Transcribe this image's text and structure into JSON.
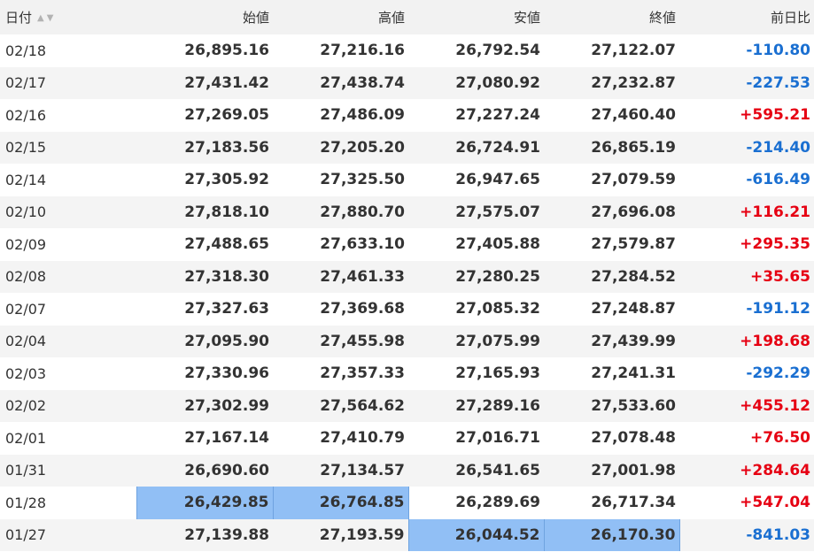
{
  "headers": {
    "date": "日付",
    "open": "始値",
    "high": "高値",
    "low": "安値",
    "close": "終値",
    "change": "前日比",
    "sort_up": "▲",
    "sort_down": "▼"
  },
  "colors": {
    "positive": "#e60012",
    "negative": "#1a6fd1",
    "highlight": "#91bff5"
  },
  "rows": [
    {
      "date": "02/18",
      "open": "26,895.16",
      "high": "27,216.16",
      "low": "26,792.54",
      "close": "27,122.07",
      "change": "-110.80"
    },
    {
      "date": "02/17",
      "open": "27,431.42",
      "high": "27,438.74",
      "low": "27,080.92",
      "close": "27,232.87",
      "change": "-227.53"
    },
    {
      "date": "02/16",
      "open": "27,269.05",
      "high": "27,486.09",
      "low": "27,227.24",
      "close": "27,460.40",
      "change": "+595.21"
    },
    {
      "date": "02/15",
      "open": "27,183.56",
      "high": "27,205.20",
      "low": "26,724.91",
      "close": "26,865.19",
      "change": "-214.40"
    },
    {
      "date": "02/14",
      "open": "27,305.92",
      "high": "27,325.50",
      "low": "26,947.65",
      "close": "27,079.59",
      "change": "-616.49"
    },
    {
      "date": "02/10",
      "open": "27,818.10",
      "high": "27,880.70",
      "low": "27,575.07",
      "close": "27,696.08",
      "change": "+116.21"
    },
    {
      "date": "02/09",
      "open": "27,488.65",
      "high": "27,633.10",
      "low": "27,405.88",
      "close": "27,579.87",
      "change": "+295.35"
    },
    {
      "date": "02/08",
      "open": "27,318.30",
      "high": "27,461.33",
      "low": "27,280.25",
      "close": "27,284.52",
      "change": "+35.65"
    },
    {
      "date": "02/07",
      "open": "27,327.63",
      "high": "27,369.68",
      "low": "27,085.32",
      "close": "27,248.87",
      "change": "-191.12"
    },
    {
      "date": "02/04",
      "open": "27,095.90",
      "high": "27,455.98",
      "low": "27,075.99",
      "close": "27,439.99",
      "change": "+198.68"
    },
    {
      "date": "02/03",
      "open": "27,330.96",
      "high": "27,357.33",
      "low": "27,165.93",
      "close": "27,241.31",
      "change": "-292.29"
    },
    {
      "date": "02/02",
      "open": "27,302.99",
      "high": "27,564.62",
      "low": "27,289.16",
      "close": "27,533.60",
      "change": "+455.12"
    },
    {
      "date": "02/01",
      "open": "27,167.14",
      "high": "27,410.79",
      "low": "27,016.71",
      "close": "27,078.48",
      "change": "+76.50"
    },
    {
      "date": "01/31",
      "open": "26,690.60",
      "high": "27,134.57",
      "low": "26,541.65",
      "close": "27,001.98",
      "change": "+284.64"
    },
    {
      "date": "01/28",
      "open": "26,429.85",
      "high": "26,764.85",
      "low": "26,289.69",
      "close": "26,717.34",
      "change": "+547.04",
      "highlighted": [
        "open",
        "high"
      ]
    },
    {
      "date": "01/27",
      "open": "27,139.88",
      "high": "27,193.59",
      "low": "26,044.52",
      "close": "26,170.30",
      "change": "-841.03",
      "highlighted": [
        "low",
        "close"
      ]
    }
  ]
}
